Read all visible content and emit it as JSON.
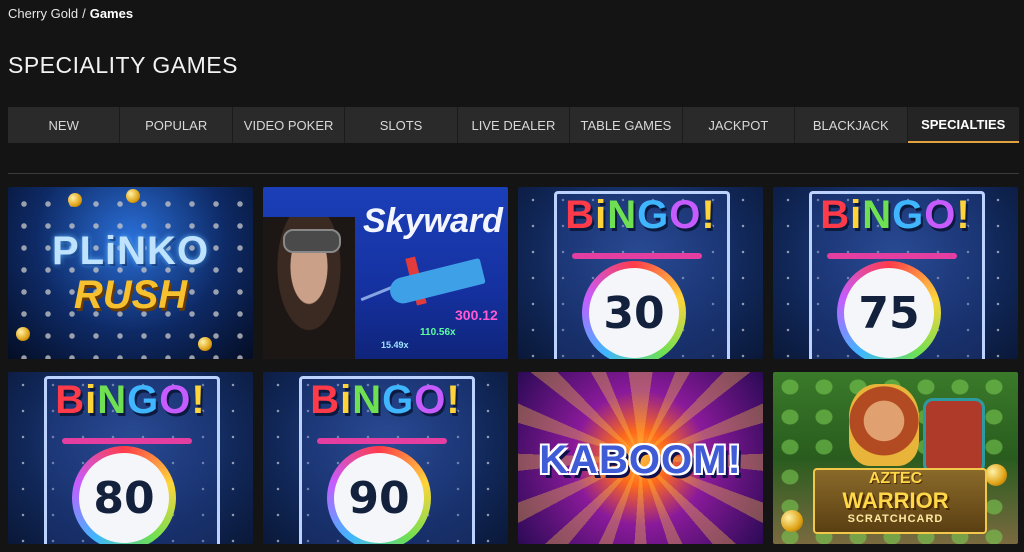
{
  "breadcrumb": {
    "home": "Cherry Gold",
    "separator": "/",
    "current": "Games"
  },
  "page_title": "SPECIALITY GAMES",
  "tabs": [
    {
      "label": "NEW",
      "active": false
    },
    {
      "label": "POPULAR",
      "active": false
    },
    {
      "label": "VIDEO POKER",
      "active": false
    },
    {
      "label": "SLOTS",
      "active": false
    },
    {
      "label": "LIVE DEALER",
      "active": false
    },
    {
      "label": "TABLE GAMES",
      "active": false
    },
    {
      "label": "JACKPOT",
      "active": false
    },
    {
      "label": "BLACKJACK",
      "active": false
    },
    {
      "label": "SPECIALTIES",
      "active": true
    }
  ],
  "colors": {
    "active_tab_underline": "#e0a340",
    "background": "#141414",
    "tab_bar": "#2a2a2a"
  },
  "games": {
    "plinko": {
      "line1": "PLiNKO",
      "line2": "RUSH"
    },
    "skyward": {
      "title": "Skyward",
      "m1": "300.12",
      "m2": "110.56x",
      "m3": "15.49x"
    },
    "bingo": {
      "b": "B",
      "i": "i",
      "n": "N",
      "g": "G",
      "o": "O",
      "excl": "!"
    },
    "bingo30": {
      "number": "30"
    },
    "bingo75": {
      "number": "75"
    },
    "bingo80": {
      "number": "80"
    },
    "bingo90": {
      "number": "90"
    },
    "kaboom": {
      "title": "KABOOM!"
    },
    "aztec": {
      "line1": "AZTEC",
      "line2": "WARRIOR",
      "line3": "SCRATCHCARD"
    }
  }
}
